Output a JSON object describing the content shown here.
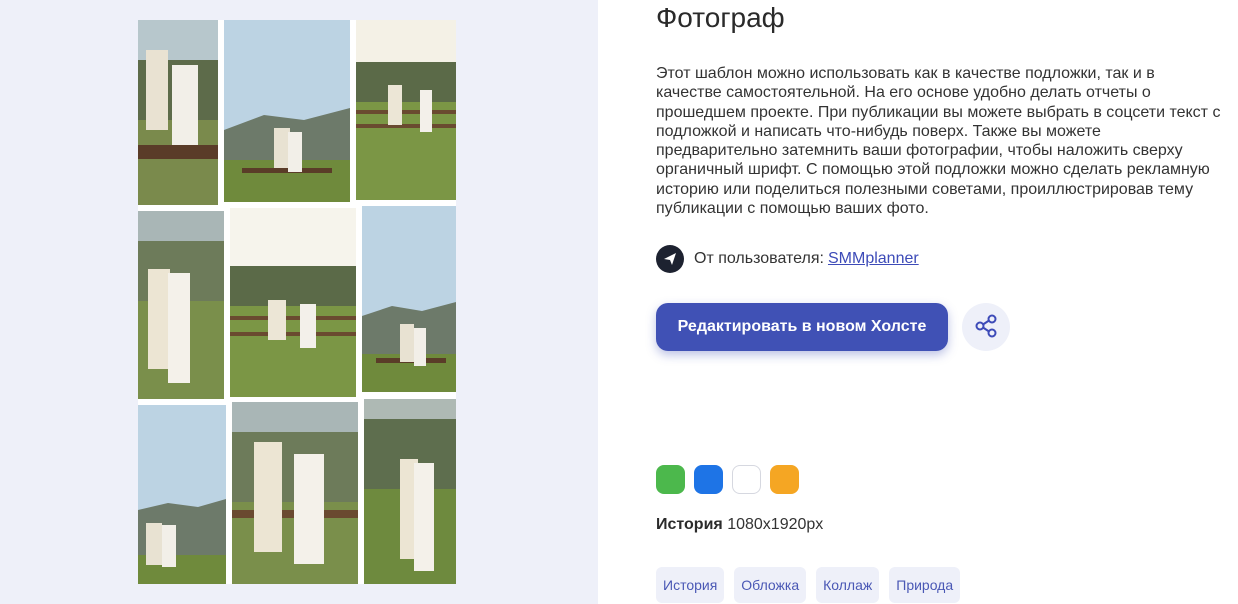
{
  "template": {
    "title": "Фотограф",
    "description": "Этот шаблон можно использовать как в качестве подложки, так и в качестве самостоятельной. На его основе удобно делать отчеты о прошедшем проекте. При публикации вы можете выбрать в соцсети текст с подложкой и написать что-нибудь поверх. Также вы можете предварительно затемнить ваши фотографии, чтобы наложить сверху органичный шрифт. С помощью этой подложки можно сделать рекламную историю или поделиться полезными советами, проиллюстрировав тему публикации с помощью ваших фото."
  },
  "author": {
    "prefix": "От пользователя:",
    "name": "SMMplanner",
    "avatar_icon": "paper-plane-icon"
  },
  "actions": {
    "edit_label": "Редактировать в новом Холсте",
    "share_icon": "share-icon"
  },
  "colors": [
    "#4cb84c",
    "#1e74e6",
    "#ffffff",
    "#f5a623"
  ],
  "format": {
    "label": "История",
    "size": "1080x1920px"
  },
  "tags": [
    "История",
    "Обложка",
    "Коллаж",
    "Природа"
  ],
  "preview": {
    "tiles": 9
  }
}
